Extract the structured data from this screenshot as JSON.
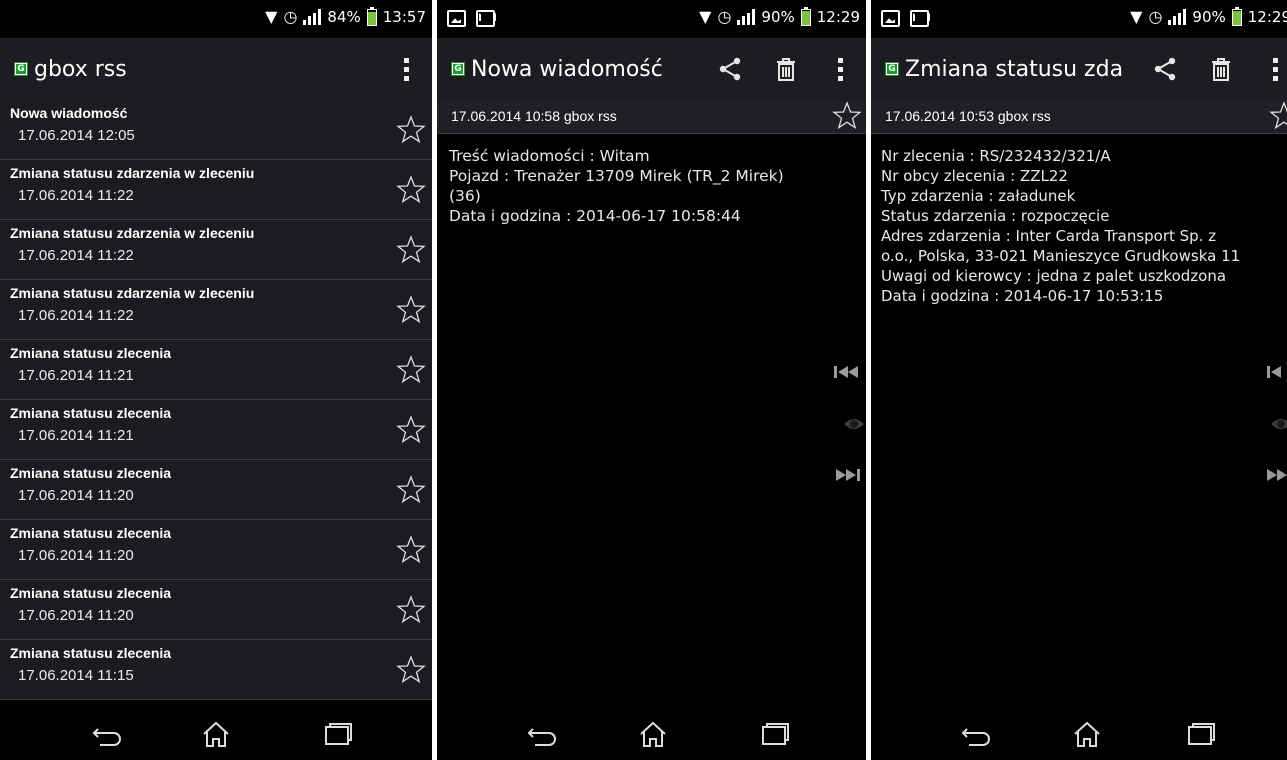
{
  "screens": [
    {
      "status": {
        "battery": "84%",
        "battery_level": 0.84,
        "time": "13:57"
      },
      "title": "gbox rss",
      "items": [
        {
          "title": "Nowa wiadomość",
          "date": "17.06.2014 12:05"
        },
        {
          "title": "Zmiana statusu zdarzenia w zleceniu",
          "date": "17.06.2014 11:22"
        },
        {
          "title": "Zmiana statusu zdarzenia w zleceniu",
          "date": "17.06.2014 11:22"
        },
        {
          "title": "Zmiana statusu zdarzenia w zleceniu",
          "date": "17.06.2014 11:22"
        },
        {
          "title": "Zmiana statusu zlecenia",
          "date": "17.06.2014 11:21"
        },
        {
          "title": "Zmiana statusu zlecenia",
          "date": "17.06.2014 11:21"
        },
        {
          "title": "Zmiana statusu zlecenia",
          "date": "17.06.2014 11:20"
        },
        {
          "title": "Zmiana statusu zlecenia",
          "date": "17.06.2014 11:20"
        },
        {
          "title": "Zmiana statusu zlecenia",
          "date": "17.06.2014 11:20"
        },
        {
          "title": "Zmiana statusu zlecenia",
          "date": "17.06.2014 11:15"
        }
      ]
    },
    {
      "status": {
        "battery": "90%",
        "battery_level": 0.9,
        "time": "12:29"
      },
      "title": "Nowa wiadomość",
      "meta": "17.06.2014 10:58 gbox rss",
      "body": "Treść wiadomości : Witam\nPojazd : Trenażer 13709 Mirek (TR_2 Mirek)\n(36)\nData i godzina : 2014-06-17 10:58:44"
    },
    {
      "status": {
        "battery": "90%",
        "battery_level": 0.9,
        "time": "12:29"
      },
      "title": "Zmiana statusu zda",
      "meta": "17.06.2014 10:53 gbox rss",
      "body": "Nr zlecenia : RS/232432/321/A\nNr obcy zlecenia : ZZL22\nTyp zdarzenia : załadunek\nStatus zdarzenia : rozpoczęcie\nAdres zdarzenia : Inter Carda Transport Sp. z\no.o., Polska, 33-021 Manieszyce Grudkowska 11\nUwagi od kierowcy : jedna z palet uszkodzona\nData i godzina : 2014-06-17 10:53:15"
    }
  ],
  "icons": {
    "notifications": [
      "image-icon",
      "gmail-icon"
    ],
    "status": [
      "nfc-icon",
      "alarm-icon",
      "signal-icon",
      "battery-icon"
    ],
    "actions": [
      "share-icon",
      "delete-icon",
      "overflow-menu-icon"
    ],
    "side": [
      "previous-icon",
      "eye-icon",
      "next-icon"
    ],
    "nav": [
      "back-icon",
      "home-icon",
      "recent-apps-icon"
    ]
  },
  "colors": {
    "battery": "#7cc242",
    "app_icon": "#1f9c32",
    "actionbar": "#1b1d20"
  }
}
